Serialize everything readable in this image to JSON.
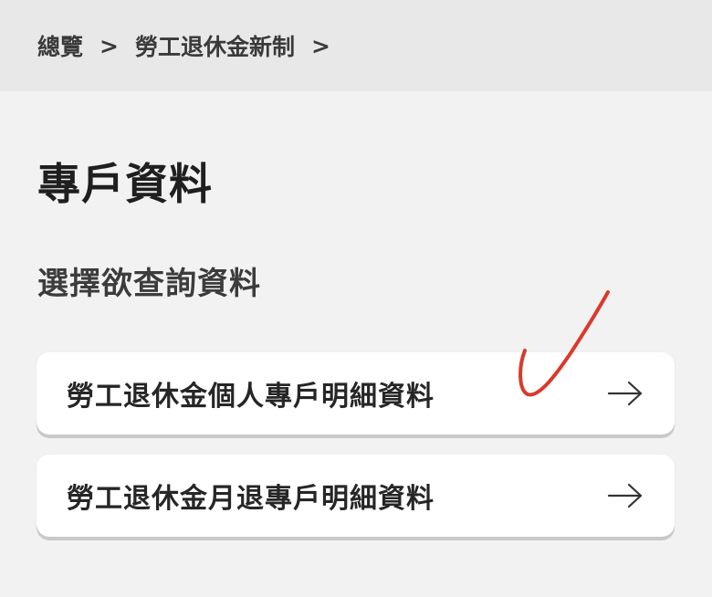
{
  "breadcrumb": {
    "items": [
      "總覽",
      "勞工退休金新制"
    ],
    "separator": ">"
  },
  "page": {
    "title": "專戶資料",
    "section_label": "選擇欲查詢資料"
  },
  "options": [
    {
      "label": "勞工退休金個人專戶明細資料",
      "icon": "arrow-right-icon"
    },
    {
      "label": "勞工退休金月退專戶明細資料",
      "icon": "arrow-right-icon"
    }
  ],
  "annotation": {
    "icon": "handwritten-checkmark",
    "color": "#d93a2b"
  },
  "colors": {
    "background": "#f2f2f2",
    "breadcrumb_bar": "#e8e8e8",
    "card": "#ffffff",
    "text": "#1f1f1f"
  }
}
